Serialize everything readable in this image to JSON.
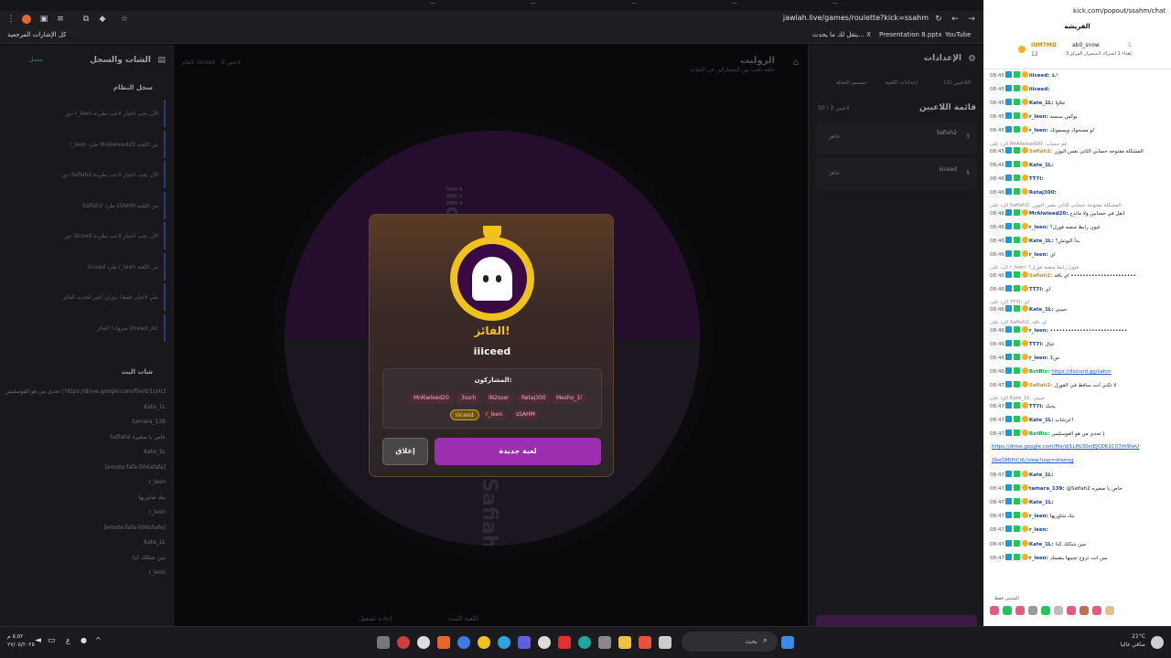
{
  "browser": {
    "url": "jawlah.live/games/roulette?kick=ssahm",
    "bookmarks": [
      "كل الإشارات المرجعية",
      "يتقل لك ما يحدث... X",
      "Presentation 8.pptx",
      "YouTube"
    ]
  },
  "app": {
    "right_panel": {
      "title": "الإعدادات",
      "tabs": [
        "اللاعبين (2)",
        "إعدادات اللعبة",
        "تصميم العجلة"
      ],
      "players_title": "قائمة اللاعبين",
      "players_count": "50 / 2 لاعبين",
      "players": [
        {
          "name": "Safiah2",
          "num": "3",
          "status": "جاهز"
        },
        {
          "name": "iiiceed",
          "num": "5",
          "status": "جاهز"
        }
      ]
    },
    "center": {
      "title": "الروليت",
      "subtitle": "حلقة تلعب بين المشاركين في الشات",
      "players_info": "2 لاعبين",
      "winner_info": "الفائز: iiiceed",
      "wheel_labels": [
        "iiiceed - 5",
        "Safiah2 - 3"
      ],
      "spin_button": "إعادة تشغيل",
      "start_button": "اللعبة الثبت"
    },
    "left_panel": {
      "title": "الشات والسجل",
      "status": "متصل",
      "log_title": "سجل النظام",
      "log_items": [
        "دور r_leen الآن يجب اختيار لاعب بطرده",
        "r_leen طرد MrAlwleed20 من اللعبة",
        "دور Safiah2 الآن يجب اختيار لاعب بطرده",
        "Safiah2 طرد sSAHM من اللعبة",
        "دور iiiceed الآن يجب اختيار لاعب بطرده",
        "iiiceed طرد r_leen من اللعبة",
        "بقي لاعبان فقط! دوران أخير لتحديد الفائز",
        "مبروك! الفائز iiiceed فاز!"
      ],
      "chat_title": "شات البث",
      "chat_items": [
        "تحدي من هو الفوسليس | https://drive.google.com/file/d/1LHLS0stEJCDK1C0Yr",
        "Kate_1L",
        "tamara_139",
        "Safiah2 خاص يا صغيره",
        "Kate_1L",
        "[emote:fafa-506afafa]",
        "r_leen",
        "بنك شاوريها",
        "r_leen",
        "[emote:fafa-506shafe]",
        "Kate_1L",
        "مين شكلك كذا",
        "r_leen"
      ]
    }
  },
  "modal": {
    "title": "الفائز!",
    "winner": "iiiceed",
    "participants_label": "المشاركون:",
    "participants": [
      "MrAlwleed20",
      "3ssrh",
      "iN2sser",
      "Retaj300",
      "Mesho_1l",
      "iiiceed",
      "r_leen",
      "sSAHM"
    ],
    "winner_participant": "iiiceed",
    "close_label": "إغلاق",
    "new_game_label": "لعبة جديدة"
  },
  "kick": {
    "url": "kick.com/popout/ssahm/chat",
    "title": "الفريشة",
    "leaderboard": {
      "top_user": "IIIM7MD",
      "top_score": "12",
      "second_user": "ab0_snow",
      "second_score": "1",
      "note": "إهداء 1 اشتراك لاستمرار المركز 3"
    },
    "messages": [
      {
        "time": "08:45",
        "user": "iiiceed:",
        "text": "يلا!"
      },
      {
        "time": "08:45",
        "user": "iiiceed:",
        "text": ""
      },
      {
        "time": "08:45",
        "user": "Kate_1L:",
        "text": "حلاوا"
      },
      {
        "time": "08:45",
        "user": "r_leen:",
        "text": "يوكس سنسه"
      },
      {
        "time": "08:45",
        "user": "r_leen:",
        "text": "لو مسحوك ويسمونك"
      },
      {
        "time": "08:45",
        "user": "Safiah2:",
        "text": "المشكلة مفتوحه حسابي الثاني نفس اليوزر",
        "reply": "الرد على MrAlwleed20: عم حساب"
      },
      {
        "time": "08:45",
        "user": "Kate_1L:",
        "text": ""
      },
      {
        "time": "08:46",
        "user": "TT7l:",
        "text": ""
      },
      {
        "time": "08:46",
        "user": "Retaj300:",
        "text": ""
      },
      {
        "time": "08:46",
        "user": "MrAlwleed20:",
        "text": "انقل في حسابين ولا ماتدخ",
        "reply": "الرد على Safiah2: المشكلة مفتوحة حسابي الثاني نفس اليوزر"
      },
      {
        "time": "08:46",
        "user": "r_leen:",
        "text": "عيون رابط منصه فورل؟"
      },
      {
        "time": "08:46",
        "user": "Kate_1L:",
        "text": "بدأ اليوتش؟"
      },
      {
        "time": "08:46",
        "user": "r_leen:",
        "text": "اي"
      },
      {
        "time": "08:46",
        "user": "Safiah2:",
        "text": "اي باقه ••••••••••••••••••••••",
        "reply": "الرد على r_leen: عيون رابط منصة فورل؟"
      },
      {
        "time": "08:46",
        "user": "TT7l:",
        "text": "اي"
      },
      {
        "time": "08:46",
        "user": "Kate_1L:",
        "text": "حبيبي",
        "reply": "الرد على TT7l: اي"
      },
      {
        "time": "08:46",
        "user": "r_leen:",
        "text": "••••••••••••••••••••••••••",
        "reply": "الرد على Safiah2: اي باقه"
      },
      {
        "time": "08:46",
        "user": "TT7l:",
        "text": "عيال"
      },
      {
        "time": "08:46",
        "user": "r_leen:",
        "text": "س1"
      },
      {
        "time": "08:46",
        "user": "BotRix:",
        "text": "https://discord.gg/sahm",
        "link": true
      },
      {
        "time": "08:47",
        "user": "Safiah2:",
        "text": "لا تكتي انت ساقط في القورل"
      },
      {
        "time": "08:47",
        "user": "TT7l:",
        "text": "يحبك",
        "reply": "الرد على Kate_1L: حبيبي"
      },
      {
        "time": "08:47",
        "user": "Kate_1L:",
        "text": "عرشاب!"
      },
      {
        "time": "08:47",
        "user": "BotRix:",
        "text": "تحدي من هو الفوسليس |"
      },
      {
        "time": "",
        "user": "",
        "text": "https://drive.google.com/file/d/1LHLS0stEJCDK1C07rh9IwU",
        "link": true
      },
      {
        "time": "",
        "user": "",
        "text": "2bxOMUhCdL/view?usp=sharing",
        "link": true
      },
      {
        "time": "08:47",
        "user": "Kate_1L:",
        "text": ""
      },
      {
        "time": "08:47",
        "user": "tamara_139:",
        "text": "@Safiah2 خاص يا صغيره"
      },
      {
        "time": "08:47",
        "user": "Kate_1L:",
        "text": ""
      },
      {
        "time": "08:47",
        "user": "r_leen:",
        "text": "بنك شاوريها"
      },
      {
        "time": "08:47",
        "user": "r_leen:",
        "text": ""
      },
      {
        "time": "08:47",
        "user": "Kate_1L:",
        "text": "مين شكلك كذا"
      },
      {
        "time": "08:47",
        "user": "r_leen:",
        "text": "بس انت تروح تجيبها بنفسك"
      }
    ],
    "pinned": "المثبتين فقط"
  },
  "taskbar": {
    "search": "بحث",
    "time": "٥:٥٢ م",
    "date": "٢٧/٠٥/٢٠٢٥",
    "weather": "21°C",
    "weather_note": "صافي غالبا",
    "lang": "ع"
  },
  "colors": {
    "accent": "#9c2fb0",
    "gold": "#f1c21b"
  }
}
